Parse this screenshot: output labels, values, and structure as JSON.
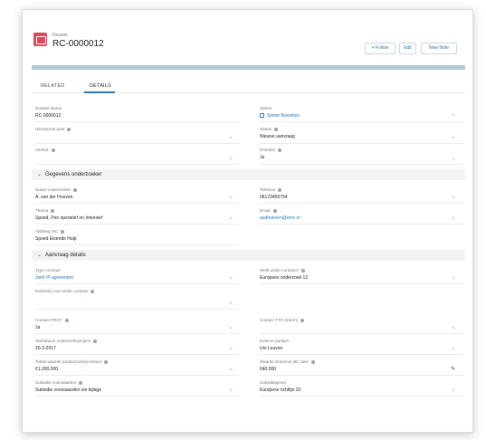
{
  "header": {
    "object_type": "Dossier",
    "title": "RC-0000012",
    "follow_label": "+ Follow",
    "edit_label": "Edit",
    "new_note_label": "New Note"
  },
  "tabs": {
    "related": "RELATED",
    "details": "DETAILS"
  },
  "fields": {
    "dossier_naam": {
      "label": "Dossier Name",
      "value": "RC-0000012"
    },
    "owner": {
      "label": "Owner",
      "value": "Simon Bouwtjes"
    },
    "uitvoerend": {
      "label": "Uitvoerend punt",
      "value": ""
    },
    "status": {
      "label": "Status",
      "value": "Nieuwe aanvraag"
    },
    "verkort": {
      "label": "Verkort",
      "value": ""
    },
    "prioriteit": {
      "label": "Prioriteit",
      "value": "Ja"
    },
    "naam_onderzoeker": {
      "label": "Naam onderzoeker",
      "value": "A. van der Hoeven"
    },
    "telefoon": {
      "label": "Telefoon",
      "value": "06123456754"
    },
    "thema": {
      "label": "Thema",
      "value": "Spoed, Pen operatief en Intensief"
    },
    "email": {
      "label": "Email",
      "value": "audhoeven@emc.nl"
    },
    "afdeling": {
      "label": "Afdeling MC",
      "value": "Spoed Eisende Hulp"
    },
    "type_contract": {
      "label": "Type contract",
      "value": "Joint IP agreement"
    },
    "welk_ander_contract": {
      "label": "Welk ander contract?",
      "value": "Europees onderzoek 12"
    },
    "reden_ander": {
      "label": "Reden(s) met ander contract",
      "value": ""
    },
    "contact_pro": {
      "label": "Contact PRO?",
      "value": "Ja"
    },
    "contact_tto": {
      "label": "Contact TTO (Intern)",
      "value": ""
    },
    "startdatum": {
      "label": "Startdatum onderzoeksproject",
      "value": "20-3-2017"
    },
    "externe_partijen": {
      "label": "Externe partijen",
      "value": "Uni Leuven"
    },
    "totale_waarde": {
      "label": "Totale waarde (onderzoeks)contract",
      "value": "€1.200.000"
    },
    "waarde_erasmus": {
      "label": "Waarde Erasmus MC deel",
      "value": "640.000"
    },
    "subsidie": {
      "label": "Subsidie voorwaarden",
      "value": "Subsidie voorwaarden zie bijlage"
    },
    "subsidiegever": {
      "label": "Subsidiegever",
      "value": "Europese richtlijn 32"
    }
  },
  "sections": {
    "gegevens": "Gegevens onderzoeker",
    "aanvraag": "Aanvraag details"
  },
  "icons": {
    "object": "file-icon",
    "info": "info-icon",
    "edit": "pencil-icon",
    "chevron": "chevron-down-icon"
  },
  "colors": {
    "brand_icon": "#d94a5c",
    "link": "#2a7ab8",
    "banner": "#b7c8d9"
  }
}
